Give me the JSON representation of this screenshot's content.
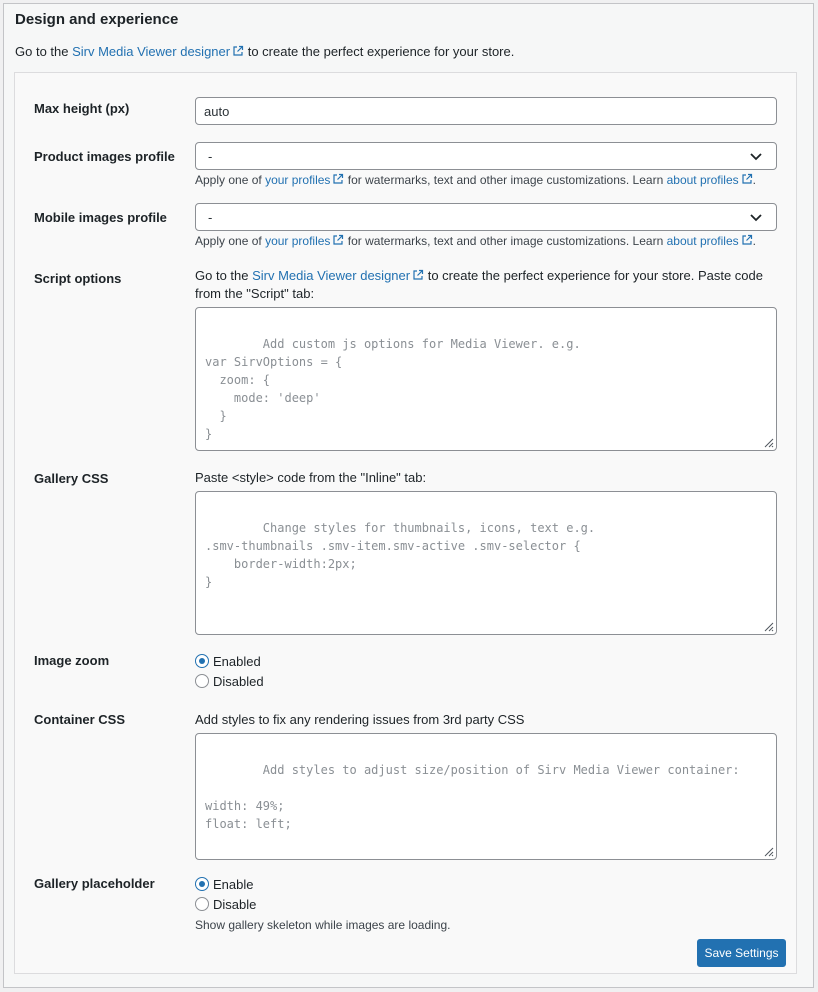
{
  "section": {
    "title": "Design and experience",
    "intro_before": "Go to the ",
    "intro_link": "Sirv Media Viewer designer",
    "intro_after": " to create the perfect experience for your store."
  },
  "max_height": {
    "label": "Max height (px)",
    "value": "auto"
  },
  "product_profile": {
    "label": "Product images profile",
    "selected": "-",
    "desc_before": "Apply one of ",
    "desc_link1": "your profiles",
    "desc_mid": " for watermarks, text and other image customizations. Learn ",
    "desc_link2": "about profiles",
    "desc_after": "."
  },
  "mobile_profile": {
    "label": "Mobile images profile",
    "selected": "-",
    "desc_before": "Apply one of ",
    "desc_link1": "your profiles",
    "desc_mid": " for watermarks, text and other image customizations. Learn ",
    "desc_link2": "about profiles",
    "desc_after": "."
  },
  "script_options": {
    "label": "Script options",
    "help_before": "Go to the ",
    "help_link": "Sirv Media Viewer designer",
    "help_after": " to create the perfect experience for your store. Paste code from the \"Script\" tab:",
    "placeholder": "Add custom js options for Media Viewer. e.g.\nvar SirvOptions = {\n  zoom: {\n    mode: 'deep'\n  }\n}"
  },
  "gallery_css": {
    "label": "Gallery CSS",
    "help": "Paste <style> code from the \"Inline\" tab:",
    "placeholder": "Change styles for thumbnails, icons, text e.g.\n.smv-thumbnails .smv-item.smv-active .smv-selector {\n    border-width:2px;\n}"
  },
  "image_zoom": {
    "label": "Image zoom",
    "options": [
      "Enabled",
      "Disabled"
    ],
    "selected": "Enabled"
  },
  "container_css": {
    "label": "Container CSS",
    "help": "Add styles to fix any rendering issues from 3rd party CSS",
    "placeholder": "Add styles to adjust size/position of Sirv Media Viewer container:\n\nwidth: 49%;\nfloat: left;"
  },
  "gallery_placeholder": {
    "label": "Gallery placeholder",
    "options": [
      "Enable",
      "Disable"
    ],
    "selected": "Enable",
    "desc": "Show gallery skeleton while images are loading."
  },
  "save_button": "Save Settings",
  "colors": {
    "link": "#2271b1",
    "primary_button": "#2271b1",
    "panel_bg": "#f9f9f9"
  },
  "icons": {
    "external": "external-link-icon",
    "chevron": "chevron-down-icon",
    "resize": "resize-grip-icon"
  }
}
